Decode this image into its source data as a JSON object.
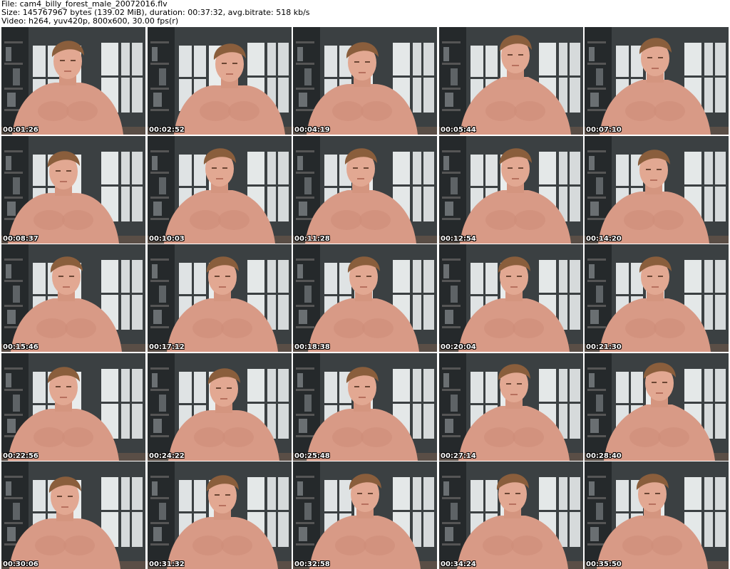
{
  "header": {
    "file_line": "File: cam4_billy_forest_male_20072016.flv",
    "size_line": "Size: 145767967 bytes (139.02 MiB), duration: 00:37:32, avg.bitrate: 518 kb/s",
    "video_line": "Video: h264, yuv420p, 800x600, 30.00 fps(r)"
  },
  "colors": {
    "background": "#ffffff",
    "timestamp_text": "#ffffff",
    "timestamp_outline": "#000000"
  },
  "thumbnails": [
    {
      "timestamp": "00:01:26"
    },
    {
      "timestamp": "00:02:52"
    },
    {
      "timestamp": "00:04:19"
    },
    {
      "timestamp": "00:05:44"
    },
    {
      "timestamp": "00:07:10"
    },
    {
      "timestamp": "00:08:37"
    },
    {
      "timestamp": "00:10:03"
    },
    {
      "timestamp": "00:11:28"
    },
    {
      "timestamp": "00:12:54"
    },
    {
      "timestamp": "00:14:20"
    },
    {
      "timestamp": "00:15:46"
    },
    {
      "timestamp": "00:17:12"
    },
    {
      "timestamp": "00:18:38"
    },
    {
      "timestamp": "00:20:04"
    },
    {
      "timestamp": "00:21:30"
    },
    {
      "timestamp": "00:22:56"
    },
    {
      "timestamp": "00:24:22"
    },
    {
      "timestamp": "00:25:48"
    },
    {
      "timestamp": "00:27:14"
    },
    {
      "timestamp": "00:28:40"
    },
    {
      "timestamp": "00:30:06"
    },
    {
      "timestamp": "00:31:32"
    },
    {
      "timestamp": "00:32:58"
    },
    {
      "timestamp": "00:34:24"
    },
    {
      "timestamp": "00:35:50"
    }
  ]
}
